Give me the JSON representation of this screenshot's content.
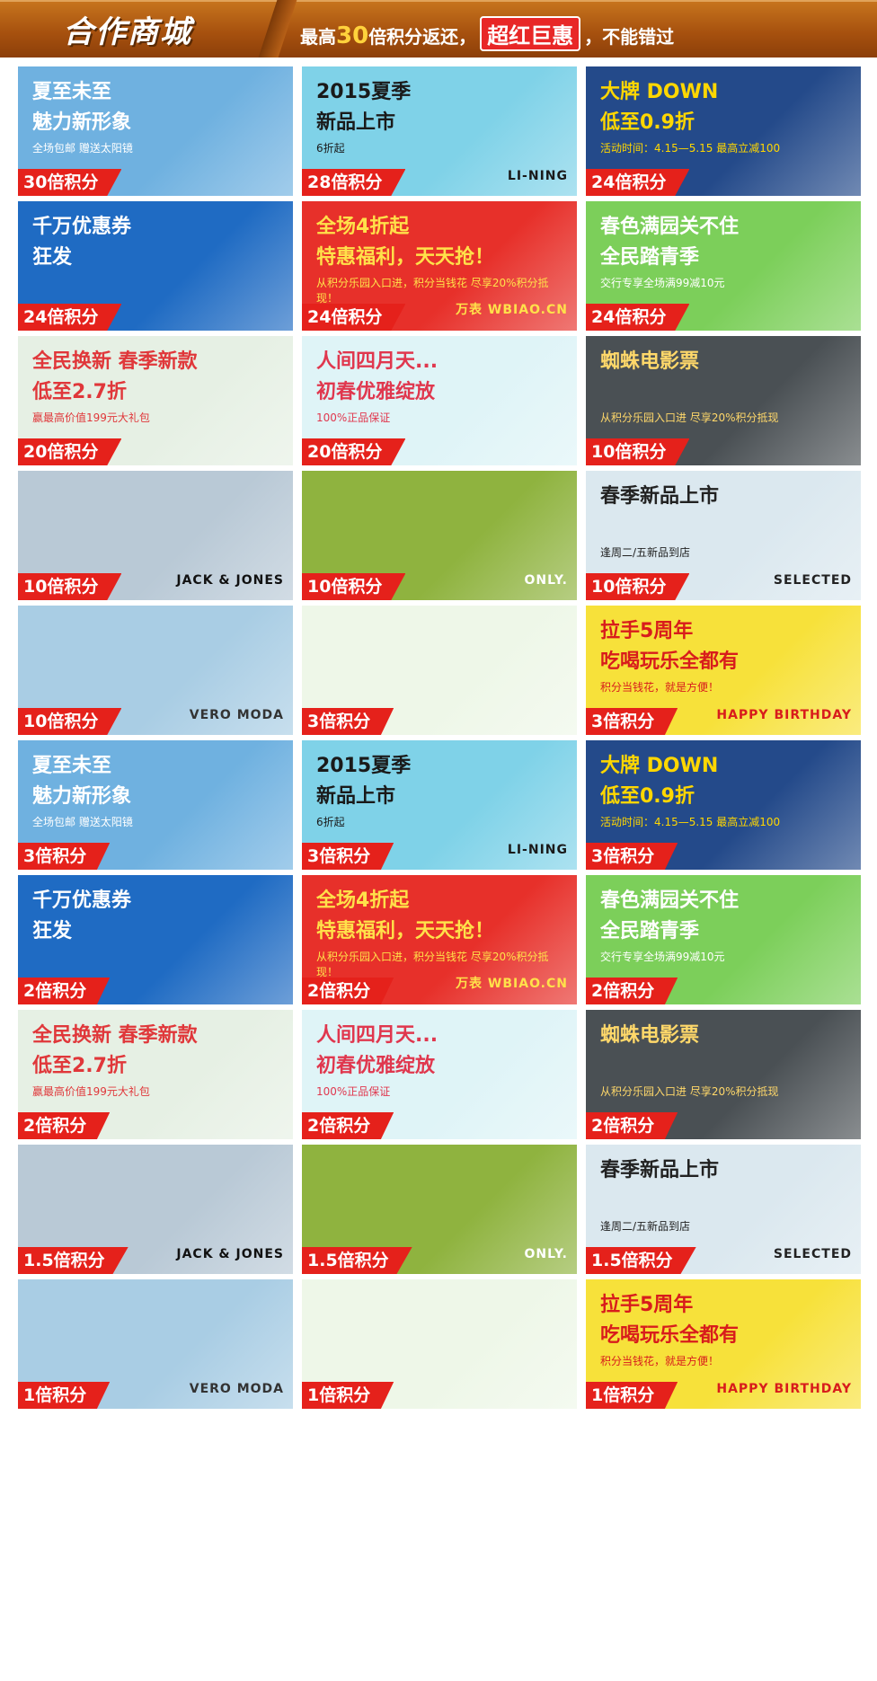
{
  "header": {
    "brand": "合作商城",
    "tagline": {
      "prefix": "最高",
      "multiplier": "30",
      "middle": "倍积分返还，",
      "highlight": "超红巨惠",
      "suffix": "，不能错过"
    }
  },
  "theme": {
    "badge_color": "#e5211b",
    "header_color": "#a8520f"
  },
  "tiles": [
    {
      "title": "夏至未至\n魅力新形象",
      "sub": "全场包邮  赠送太阳镜",
      "brand": "",
      "badge": "30倍积分",
      "bg": "#6fb1e0",
      "fg": "#ffffff"
    },
    {
      "title": "2015夏季\n新品上市",
      "sub": "6折起",
      "brand": "LI-NING",
      "badge": "28倍积分",
      "bg": "#7fd2e8",
      "fg": "#1a1a1a"
    },
    {
      "title": "大牌 DOWN\n低至0.9折",
      "sub": "活动时间：4.15—5.15  最高立减100",
      "brand": "",
      "badge": "24倍积分",
      "bg": "#244a8a",
      "fg": "#ffd700"
    },
    {
      "title": "千万优惠券\n狂发",
      "sub": "",
      "brand": "",
      "badge": "24倍积分",
      "bg": "#1f6bc3",
      "fg": "#ffffff"
    },
    {
      "title": "全场4折起\n特惠福利，天天抢！",
      "sub": "从积分乐园入口进，积分当钱花 尽享20%积分抵现！",
      "brand": "万表 WBIAO.CN",
      "badge": "24倍积分",
      "bg": "#e7302a",
      "fg": "#ffe14a"
    },
    {
      "title": "春色满园关不住\n全民踏青季",
      "sub": "交行专享全场满99减10元",
      "brand": "",
      "badge": "24倍积分",
      "bg": "#7ccf5a",
      "fg": "#ffffff"
    },
    {
      "title": "全民换新 春季新款\n低至2.7折",
      "sub": "赢最高价值199元大礼包",
      "brand": "",
      "badge": "20倍积分",
      "bg": "#e6f0e4",
      "fg": "#e0373a"
    },
    {
      "title": "人间四月天...\n初春优雅绽放",
      "sub": "100%正品保证",
      "brand": "",
      "badge": "20倍积分",
      "bg": "#dff4f7",
      "fg": "#e0374e"
    },
    {
      "title": "蜘蛛电影票",
      "sub": "从积分乐园入口进 尽享20%积分抵现",
      "brand": "",
      "badge": "10倍积分",
      "bg": "#4a5054",
      "fg": "#ffd86a"
    },
    {
      "title": "",
      "sub": "",
      "brand": "JACK & JONES",
      "badge": "10倍积分",
      "bg": "#b9c9d6",
      "fg": "#111111"
    },
    {
      "title": "",
      "sub": "",
      "brand": "ONLY.",
      "badge": "10倍积分",
      "bg": "#8fb33f",
      "fg": "#ffffff"
    },
    {
      "title": "春季新品上市",
      "sub": "逢周二/五新品到店",
      "brand": "SELECTED",
      "badge": "10倍积分",
      "bg": "#dbe8ef",
      "fg": "#222222"
    },
    {
      "title": "",
      "sub": "",
      "brand": "VERO MODA",
      "badge": "10倍积分",
      "bg": "#a9cde4",
      "fg": "#333333"
    },
    {
      "title": "",
      "sub": "",
      "brand": "",
      "badge": "3倍积分",
      "bg": "#eef7e8",
      "fg": "#333333"
    },
    {
      "title": "拉手5周年\n吃喝玩乐全都有",
      "sub": "积分当钱花，就是方便！",
      "brand": "HAPPY BIRTHDAY",
      "badge": "3倍积分",
      "bg": "#f7e13a",
      "fg": "#d81c1c"
    },
    {
      "title": "夏至未至\n魅力新形象",
      "sub": "全场包邮  赠送太阳镜",
      "brand": "",
      "badge": "3倍积分",
      "bg": "#6fb1e0",
      "fg": "#ffffff"
    },
    {
      "title": "2015夏季\n新品上市",
      "sub": "6折起",
      "brand": "LI-NING",
      "badge": "3倍积分",
      "bg": "#7fd2e8",
      "fg": "#1a1a1a"
    },
    {
      "title": "大牌 DOWN\n低至0.9折",
      "sub": "活动时间：4.15—5.15  最高立减100",
      "brand": "",
      "badge": "3倍积分",
      "bg": "#244a8a",
      "fg": "#ffd700"
    },
    {
      "title": "千万优惠券\n狂发",
      "sub": "",
      "brand": "",
      "badge": "2倍积分",
      "bg": "#1f6bc3",
      "fg": "#ffffff"
    },
    {
      "title": "全场4折起\n特惠福利，天天抢！",
      "sub": "从积分乐园入口进，积分当钱花 尽享20%积分抵现！",
      "brand": "万表 WBIAO.CN",
      "badge": "2倍积分",
      "bg": "#e7302a",
      "fg": "#ffe14a"
    },
    {
      "title": "春色满园关不住\n全民踏青季",
      "sub": "交行专享全场满99减10元",
      "brand": "",
      "badge": "2倍积分",
      "bg": "#7ccf5a",
      "fg": "#ffffff"
    },
    {
      "title": "全民换新 春季新款\n低至2.7折",
      "sub": "赢最高价值199元大礼包",
      "brand": "",
      "badge": "2倍积分",
      "bg": "#e6f0e4",
      "fg": "#e0373a"
    },
    {
      "title": "人间四月天...\n初春优雅绽放",
      "sub": "100%正品保证",
      "brand": "",
      "badge": "2倍积分",
      "bg": "#dff4f7",
      "fg": "#e0374e"
    },
    {
      "title": "蜘蛛电影票",
      "sub": "从积分乐园入口进 尽享20%积分抵现",
      "brand": "",
      "badge": "2倍积分",
      "bg": "#4a5054",
      "fg": "#ffd86a"
    },
    {
      "title": "",
      "sub": "",
      "brand": "JACK & JONES",
      "badge": "1.5倍积分",
      "bg": "#b9c9d6",
      "fg": "#111111"
    },
    {
      "title": "",
      "sub": "",
      "brand": "ONLY.",
      "badge": "1.5倍积分",
      "bg": "#8fb33f",
      "fg": "#ffffff"
    },
    {
      "title": "春季新品上市",
      "sub": "逢周二/五新品到店",
      "brand": "SELECTED",
      "badge": "1.5倍积分",
      "bg": "#dbe8ef",
      "fg": "#222222"
    },
    {
      "title": "",
      "sub": "",
      "brand": "VERO MODA",
      "badge": "1倍积分",
      "bg": "#a9cde4",
      "fg": "#333333"
    },
    {
      "title": "",
      "sub": "",
      "brand": "",
      "badge": "1倍积分",
      "bg": "#eef7e8",
      "fg": "#333333"
    },
    {
      "title": "拉手5周年\n吃喝玩乐全都有",
      "sub": "积分当钱花，就是方便！",
      "brand": "HAPPY BIRTHDAY",
      "badge": "1倍积分",
      "bg": "#f7e13a",
      "fg": "#d81c1c"
    }
  ]
}
